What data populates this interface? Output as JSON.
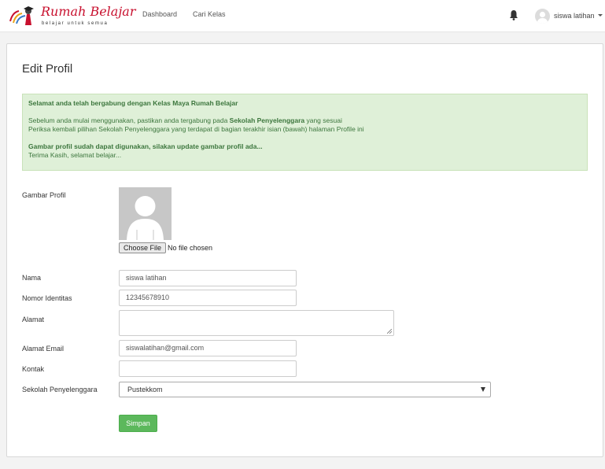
{
  "brand": {
    "name": "Rumah Belajar",
    "tagline": "belajar untuk semua"
  },
  "nav": {
    "links": [
      "Dashboard",
      "Cari Kelas"
    ],
    "user_name": "siswa latihan"
  },
  "page": {
    "title": "Edit Profil"
  },
  "alert": {
    "heading": "Selamat anda telah bergabung dengan Kelas Maya Rumah Belajar",
    "line1_prefix": "Sebelum anda mulai menggunakan, pastikan anda tergabung pada ",
    "line1_bold": "Sekolah Penyelenggara",
    "line1_suffix": " yang sesuai",
    "line2": "Periksa kembali pilihan Sekolah Penyelenggara yang terdapat di bagian terakhir isian (bawah) halaman Profile ini",
    "heading2": "Gambar profil sudah dapat digunakan, silakan update gambar profil ada...",
    "line3": "Terima Kasih, selamat belajar..."
  },
  "form": {
    "profile_picture_label": "Gambar Profil",
    "file_button_label": "Choose File",
    "file_status": "No file chosen",
    "name_label": "Nama",
    "name_value": "siswa latihan",
    "id_label": "Nomor Identitas",
    "id_value": "12345678910",
    "address_label": "Alamat",
    "address_value": "",
    "email_label": "Alamat Email",
    "email_value": "siswalatihan@gmail.com",
    "contact_label": "Kontak",
    "contact_value": "",
    "school_label": "Sekolah Penyelenggara",
    "school_value": "Pustekkom",
    "save_label": "Simpan"
  },
  "colors": {
    "brand_red": "#c8102e",
    "alert_bg": "#dff0d8",
    "alert_text": "#3c763d",
    "save_button": "#5cb85c"
  },
  "icons": [
    "logo-icon",
    "bell-icon",
    "user-avatar-icon",
    "chevron-down-icon",
    "default-profile-icon",
    "dropdown-arrow-icon"
  ]
}
